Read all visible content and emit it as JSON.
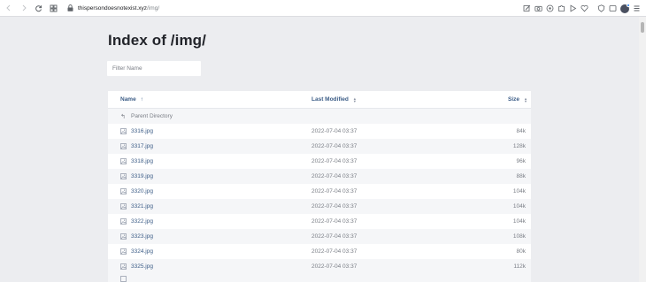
{
  "browser": {
    "url_host": "thispersondoesnotexist.xyz",
    "url_path": "/img/",
    "icons": [
      "back-icon",
      "forward-icon",
      "reload-icon",
      "site-info-icon",
      "lock-icon"
    ],
    "extension_icons": [
      "edit-icon",
      "camera-icon",
      "extension-icon",
      "play-icon",
      "heart-icon",
      "profile-icon",
      "menu-icon"
    ],
    "accent_color": "#1a73e8"
  },
  "page": {
    "title": "Index of /img/",
    "filter_placeholder": "Filter Name",
    "columns": {
      "name": "Name",
      "last_modified": "Last Modified",
      "size": "Size"
    },
    "parent_directory": "Parent Directory",
    "files": [
      {
        "name": "3316.jpg",
        "modified": "2022-07-04 03:37",
        "size": "84k"
      },
      {
        "name": "3317.jpg",
        "modified": "2022-07-04 03:37",
        "size": "128k"
      },
      {
        "name": "3318.jpg",
        "modified": "2022-07-04 03:37",
        "size": "96k"
      },
      {
        "name": "3319.jpg",
        "modified": "2022-07-04 03:37",
        "size": "88k"
      },
      {
        "name": "3320.jpg",
        "modified": "2022-07-04 03:37",
        "size": "104k"
      },
      {
        "name": "3321.jpg",
        "modified": "2022-07-04 03:37",
        "size": "104k"
      },
      {
        "name": "3322.jpg",
        "modified": "2022-07-04 03:37",
        "size": "104k"
      },
      {
        "name": "3323.jpg",
        "modified": "2022-07-04 03:37",
        "size": "108k"
      },
      {
        "name": "3324.jpg",
        "modified": "2022-07-04 03:37",
        "size": "80k"
      },
      {
        "name": "3325.jpg",
        "modified": "2022-07-04 03:37",
        "size": "112k"
      }
    ],
    "link_color": "#3b5c86"
  }
}
